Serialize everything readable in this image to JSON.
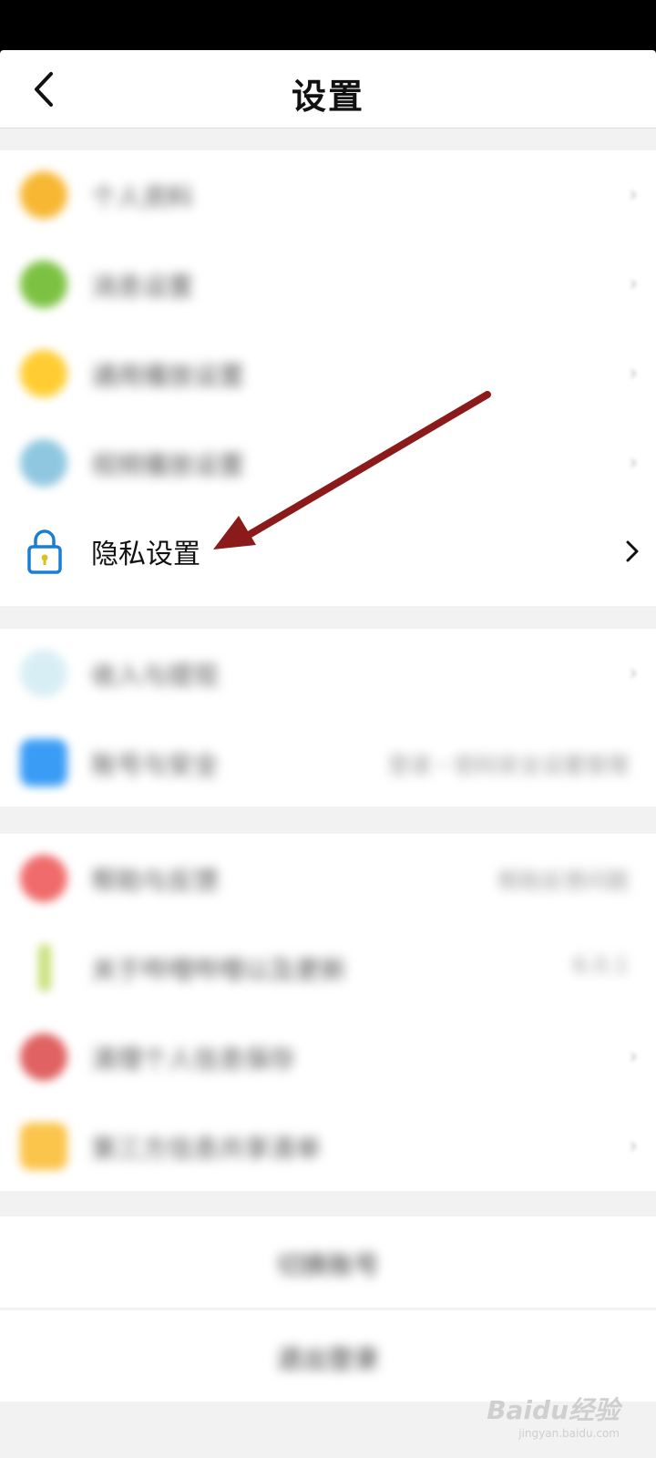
{
  "header": {
    "title": "设置"
  },
  "privacy": {
    "label": "隐私设置"
  },
  "group1": [
    {
      "label": "个人资料",
      "icon": "avatar-icon",
      "color": "#f7b733"
    },
    {
      "label": "消息设置",
      "icon": "message-icon",
      "color": "#7cc242"
    },
    {
      "label": "通用播放设置",
      "icon": "play-icon",
      "color": "#ffcd32"
    },
    {
      "label": "视频播放设置",
      "icon": "video-icon",
      "color": "#8fc7e0"
    }
  ],
  "group2": [
    {
      "label": "收入与提现",
      "icon": "income-icon",
      "color": "#d8eef5",
      "value": ""
    },
    {
      "label": "账号与安全",
      "icon": "account-icon",
      "color": "#3a9cf5",
      "value": "登录・密码安全设置管理"
    }
  ],
  "group3": [
    {
      "label": "帮助与反馈",
      "icon": "help-icon",
      "color": "#f06b6b",
      "value": "帮助反馈问题"
    },
    {
      "label": "关于哔哩哔哩以及更新",
      "icon": "about-icon",
      "color": "#c8e07a",
      "value": "6.0.1"
    },
    {
      "label": "清理个人信息保存",
      "icon": "clear-icon",
      "color": "#e06262",
      "value": ""
    },
    {
      "label": "第三方信息共享清单",
      "icon": "share-icon",
      "color": "#fbc44a",
      "value": ""
    }
  ],
  "bottom": {
    "switch_account": "切换账号",
    "logout": "退出登录"
  },
  "watermark": {
    "logo": "Baidu经验",
    "url": "jingyan.baidu.com"
  },
  "colors": {
    "arrow": "#8b1a1a",
    "lock": "#1a7fd4"
  }
}
